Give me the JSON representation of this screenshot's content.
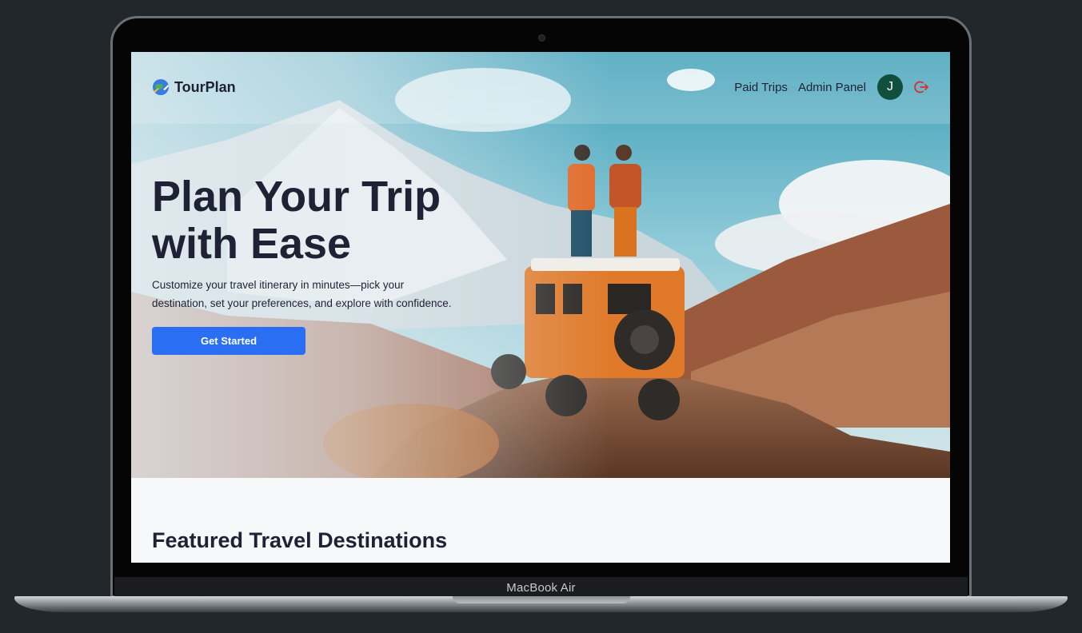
{
  "device": {
    "label": "MacBook Air"
  },
  "navbar": {
    "brand": "TourPlan",
    "links": [
      "Paid Trips",
      "Admin Panel"
    ],
    "avatar_initial": "J"
  },
  "hero": {
    "title_line1": "Plan Your Trip",
    "title_line2": "with Ease",
    "subtitle_line1": "Customize your travel itinerary in minutes—pick your",
    "subtitle_line2": "destination, set your preferences, and explore with confidence.",
    "cta_label": "Get Started"
  },
  "sections": {
    "featured_title": "Featured Travel Destinations"
  },
  "colors": {
    "accent": "#2a6ff3",
    "avatar_bg": "#0f4f3b",
    "logout": "#d9302f",
    "text_dark": "#1f2134",
    "laptop_bg": "#22272b"
  },
  "icons": {
    "logo": "globe-airplane-icon",
    "logout": "power-logout-icon"
  }
}
